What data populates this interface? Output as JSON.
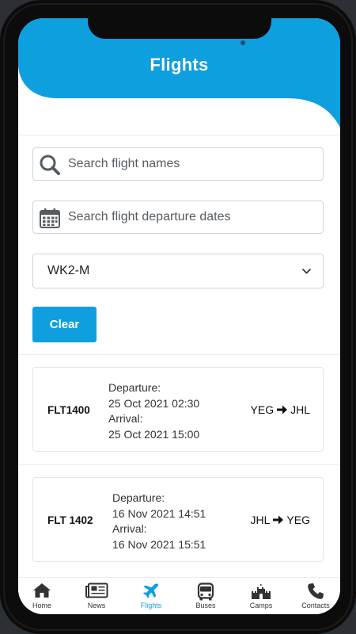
{
  "header": {
    "title": "Flights"
  },
  "search": {
    "name_placeholder": "Search flight names",
    "date_placeholder": "Search flight departure dates"
  },
  "filter": {
    "selected": "WK2-M"
  },
  "clear_label": "Clear",
  "flights": [
    {
      "code": "FLT1400",
      "departure_label": "Departure:",
      "departure": "25 Oct 2021 02:30",
      "arrival_label": "Arrival:",
      "arrival": "25 Oct 2021 15:00",
      "origin": "YEG",
      "destination": "JHL"
    },
    {
      "code": "FLT 1402",
      "departure_label": "Departure:",
      "departure": "16 Nov 2021 14:51",
      "arrival_label": "Arrival:",
      "arrival": "16 Nov 2021 15:51",
      "origin": "JHL",
      "destination": "YEG"
    }
  ],
  "nav": [
    {
      "label": "Home",
      "icon": "home-icon"
    },
    {
      "label": "News",
      "icon": "newspaper-icon"
    },
    {
      "label": "Flights",
      "icon": "plane-icon",
      "active": true
    },
    {
      "label": "Buses",
      "icon": "bus-icon"
    },
    {
      "label": "Camps",
      "icon": "castle-icon"
    },
    {
      "label": "Contacts",
      "icon": "phone-icon"
    }
  ],
  "colors": {
    "accent": "#0f9fde",
    "header": "#0e9fdf"
  }
}
